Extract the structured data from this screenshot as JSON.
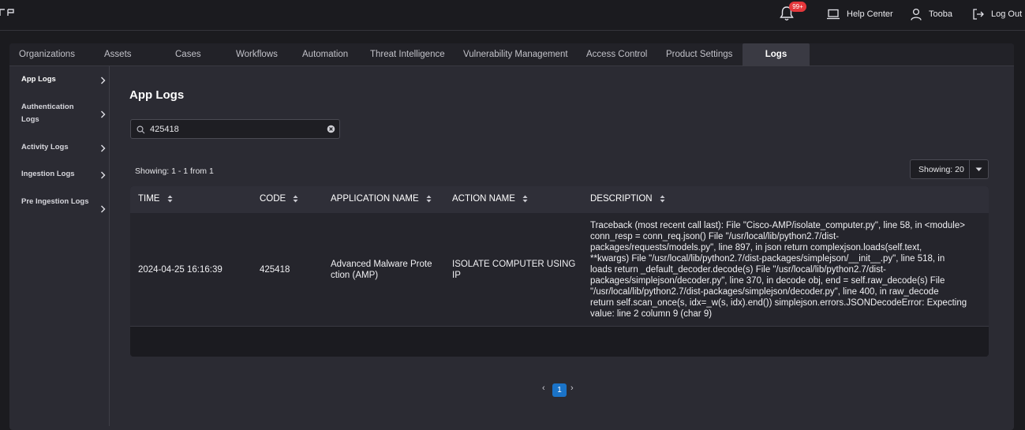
{
  "header": {
    "notification_count": "99+",
    "help_label": "Help Center",
    "user_name": "Tooba",
    "logout_label": "Log Out"
  },
  "tabs": [
    {
      "label": "Organizations"
    },
    {
      "label": "Assets"
    },
    {
      "label": "Cases"
    },
    {
      "label": "Workflows"
    },
    {
      "label": "Automation"
    },
    {
      "label": "Threat Intelligence"
    },
    {
      "label": "Vulnerability Management"
    },
    {
      "label": "Access Control"
    },
    {
      "label": "Product Settings"
    },
    {
      "label": "Logs",
      "active": true
    }
  ],
  "sidebar": {
    "items": [
      {
        "label": "App Logs",
        "active": true
      },
      {
        "label": "Authentication Logs"
      },
      {
        "label": "Activity Logs"
      },
      {
        "label": "Ingestion Logs"
      },
      {
        "label": "Pre Ingestion Logs"
      }
    ]
  },
  "main": {
    "title": "App Logs",
    "search_value": "425418",
    "showing_text": "Showing: 1 - 1 from 1",
    "page_size_label": "Showing: 20"
  },
  "table": {
    "columns": [
      "TIME",
      "CODE",
      "APPLICATION NAME",
      "ACTION NAME",
      "DESCRIPTION"
    ],
    "rows": [
      {
        "time": "2024-04-25 16:16:39",
        "code": "425418",
        "application_lines": [
          "Advanced Malware Prote",
          "ction (AMP)"
        ],
        "action_lines": [
          "ISOLATE COMPUTER USING",
          "IP"
        ],
        "description_lines": [
          "Traceback (most recent call last): File \"Cisco-AMP/isolate_computer.py\", line 58, in <module>",
          "conn_resp = conn_req.json() File \"/usr/local/lib/python2.7/dist-",
          "packages/requests/models.py\", line 897, in json return complexjson.loads(self.text,",
          "**kwargs) File \"/usr/local/lib/python2.7/dist-packages/simplejson/__init__.py\", line 518, in",
          "loads return _default_decoder.decode(s) File \"/usr/local/lib/python2.7/dist-",
          "packages/simplejson/decoder.py\", line 370, in decode obj, end = self.raw_decode(s) File",
          "\"/usr/local/lib/python2.7/dist-packages/simplejson/decoder.py\", line 400, in raw_decode",
          "return self.scan_once(s, idx=_w(s, idx).end()) simplejson.errors.JSONDecodeError: Expecting",
          "value: line 2 column 9 (char 9)"
        ]
      }
    ]
  },
  "pagination": {
    "prev": "‹",
    "current": "1",
    "next": "›"
  }
}
